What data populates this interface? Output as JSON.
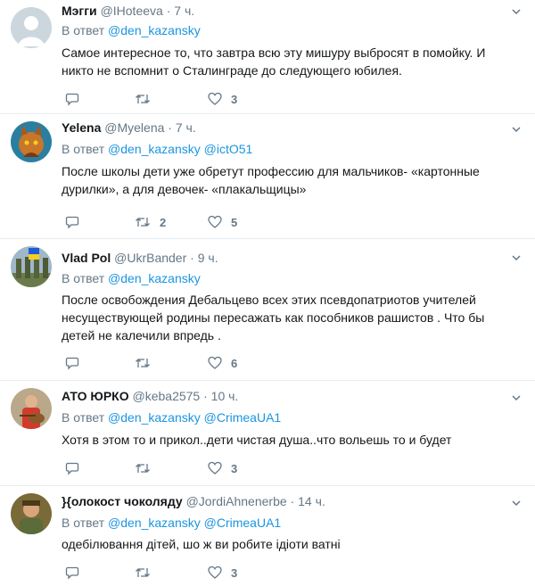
{
  "tweets": [
    {
      "name": "Мэгги",
      "handle": "@IHoteeva",
      "dot": "·",
      "time": "7 ч.",
      "reply_prefix": "В ответ",
      "mentions": [
        "@den_kazansky"
      ],
      "text": "Самое интересное то, что завтра всю эту мишуру выбросят в помойку. И никто не вспомнит о Сталинграде до следующего юбилея.",
      "replies": "",
      "retweets": "",
      "likes": "3",
      "avatar": "default-avatar-icon"
    },
    {
      "name": "Yelena",
      "handle": "@Myelena",
      "dot": "·",
      "time": "7 ч.",
      "reply_prefix": "В ответ",
      "mentions": [
        "@den_kazansky",
        "@ictO51"
      ],
      "text": "После школы дети уже обретут профессию для мальчиков- «картонные дурилки», а для девочек- «плакальщицы»",
      "replies": "",
      "retweets": "2",
      "likes": "5",
      "avatar": "cat-avatar"
    },
    {
      "name": "Vlad Pol",
      "handle": "@UkrBander",
      "dot": "·",
      "time": "9 ч.",
      "reply_prefix": "В ответ",
      "mentions": [
        "@den_kazansky"
      ],
      "text": "После освобождения Дебальцево всех этих псевдопатриотов  учителей несуществующей родины пересажать  как пособников рашистов . Что бы детей не калечили впредь .",
      "replies": "",
      "retweets": "",
      "likes": "6",
      "avatar": "soldiers-avatar"
    },
    {
      "name": "АТО ЮРКО",
      "handle": "@keba2575",
      "dot": "·",
      "time": "10 ч.",
      "reply_prefix": "В ответ",
      "mentions": [
        "@den_kazansky",
        "@CrimeaUA1"
      ],
      "text": "Хотя в этом то и прикол..дети чистая душа..что вольешь то и будет",
      "replies": "",
      "retweets": "",
      "likes": "3",
      "avatar": "guitar-player-avatar"
    },
    {
      "name": "}{олокост чоколяду",
      "handle": "@JordiAhnenerbe",
      "dot": "·",
      "time": "14 ч.",
      "reply_prefix": "В ответ",
      "mentions": [
        "@den_kazansky",
        "@CrimeaUA1"
      ],
      "text": "одебілювання дітей, шо ж ви робите ідіоти ватні",
      "replies": "",
      "retweets": "",
      "likes": "3",
      "avatar": "man-portrait-avatar"
    }
  ]
}
